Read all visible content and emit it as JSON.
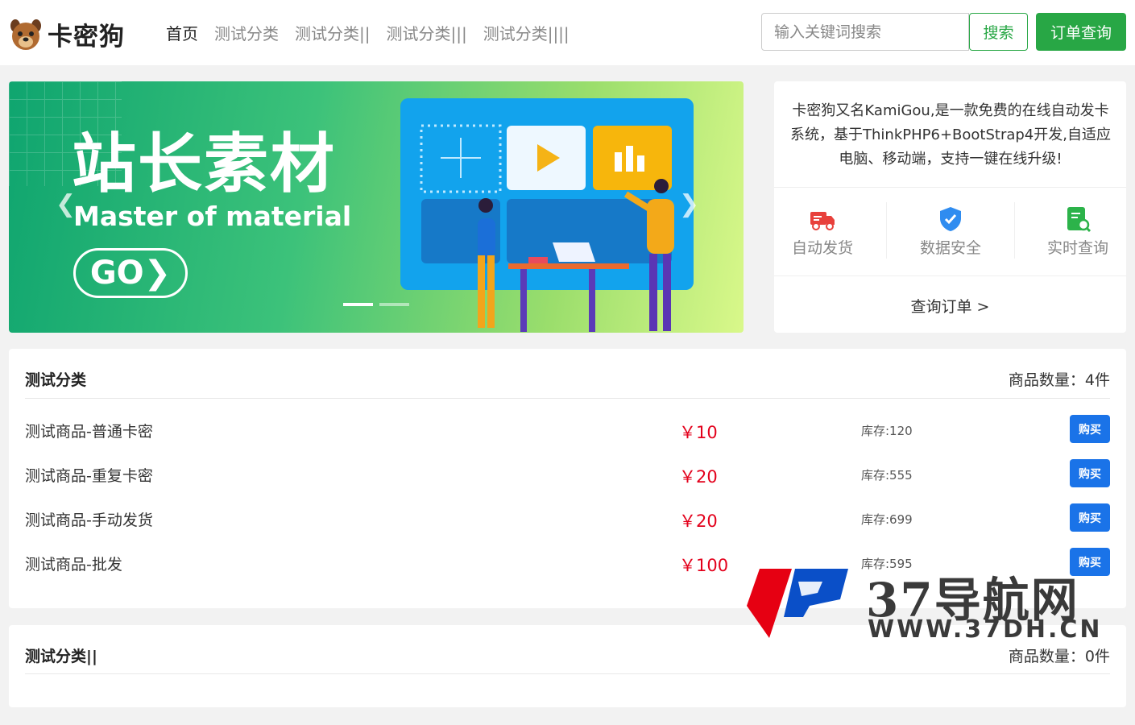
{
  "header": {
    "logo_text": "卡密狗",
    "nav": [
      {
        "label": "首页",
        "active": true
      },
      {
        "label": "测试分类",
        "active": false
      },
      {
        "label": "测试分类||",
        "active": false
      },
      {
        "label": "测试分类|||",
        "active": false
      },
      {
        "label": "测试分类||||",
        "active": false
      }
    ],
    "search_placeholder": "输入关键词搜索",
    "search_label": "搜索",
    "order_query_label": "订单查询"
  },
  "banner": {
    "title": "站长素材",
    "subtitle": "Master of material",
    "go_label": "GO❯",
    "prev_icon": "chevron-left-icon",
    "next_icon": "chevron-right-icon",
    "slide_count": 2,
    "active_slide": 1
  },
  "info": {
    "description": "卡密狗又名KamiGou,是一款免费的在线自动发卡系统，基于ThinkPHP6+BootStrap4开发,自适应电脑、移动端，支持一键在线升级!",
    "features": [
      {
        "label": "自动发货",
        "icon": "truck-icon",
        "color": "#e8413c"
      },
      {
        "label": "数据安全",
        "icon": "shield-check-icon",
        "color": "#2f8cf0"
      },
      {
        "label": "实时查询",
        "icon": "search-doc-icon",
        "color": "#2cb34a"
      }
    ],
    "query_link": "查询订单 >"
  },
  "categories": [
    {
      "title": "测试分类",
      "count_label": "商品数量：4件",
      "products": [
        {
          "name": "测试商品-普通卡密",
          "price": "￥10",
          "stock": "库存:120",
          "buy": "购买"
        },
        {
          "name": "测试商品-重复卡密",
          "price": "￥20",
          "stock": "库存:555",
          "buy": "购买"
        },
        {
          "name": "测试商品-手动发货",
          "price": "￥20",
          "stock": "库存:699",
          "buy": "购买"
        },
        {
          "name": "测试商品-批发",
          "price": "￥100",
          "stock": "库存:595",
          "buy": "购买"
        }
      ]
    },
    {
      "title": "测试分类||",
      "count_label": "商品数量：0件",
      "products": []
    }
  ],
  "watermark": {
    "title": "37导航网",
    "url": "WWW.37DH.CN"
  },
  "colors": {
    "accent_green": "#28a745",
    "price_red": "#e3001b",
    "buy_blue": "#1a73e8"
  }
}
